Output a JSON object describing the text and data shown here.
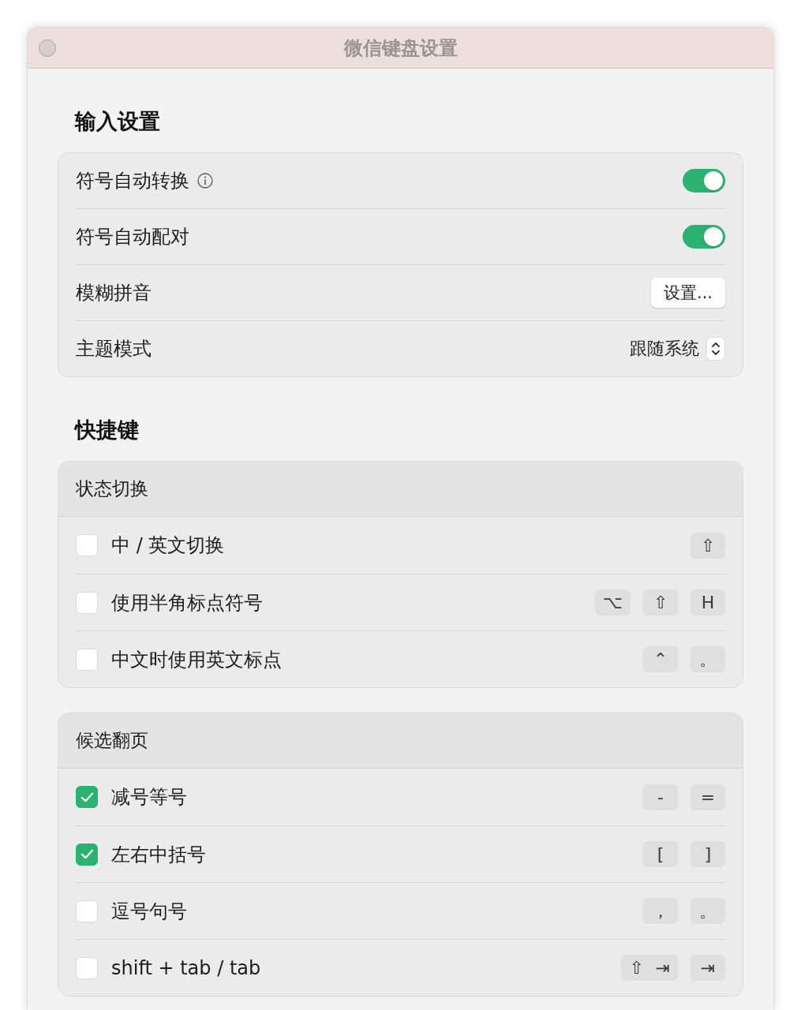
{
  "window": {
    "title": "微信键盘设置"
  },
  "input_settings": {
    "heading": "输入设置",
    "rows": [
      {
        "kind": "toggle",
        "label": "符号自动转换",
        "info": true,
        "on": true
      },
      {
        "kind": "toggle",
        "label": "符号自动配对",
        "info": false,
        "on": true
      },
      {
        "kind": "button",
        "label": "模糊拼音",
        "info": false,
        "button": "设置..."
      },
      {
        "kind": "popup",
        "label": "主题模式",
        "info": false,
        "value": "跟随系统"
      }
    ]
  },
  "shortcuts": {
    "heading": "快捷键",
    "groups": [
      {
        "title": "状态切换",
        "rows": [
          {
            "label": "中 / 英文切换",
            "checked": false,
            "keys": [
              "⇧"
            ]
          },
          {
            "label": "使用半角标点符号",
            "checked": false,
            "keys": [
              "⌥",
              "⇧",
              "H"
            ]
          },
          {
            "label": "中文时使用英文标点",
            "checked": false,
            "keys": [
              "⌃",
              "。"
            ]
          }
        ]
      },
      {
        "title": "候选翻页",
        "rows": [
          {
            "label": "减号等号",
            "checked": true,
            "keys": [
              "-",
              "="
            ]
          },
          {
            "label": "左右中括号",
            "checked": true,
            "keys": [
              "[",
              "]"
            ]
          },
          {
            "label": "逗号句号",
            "checked": false,
            "keys": [
              "，",
              "。"
            ]
          },
          {
            "label": "shift + tab / tab",
            "checked": false,
            "keys": [
              "⇧ ⇥",
              "⇥"
            ]
          }
        ]
      }
    ]
  }
}
